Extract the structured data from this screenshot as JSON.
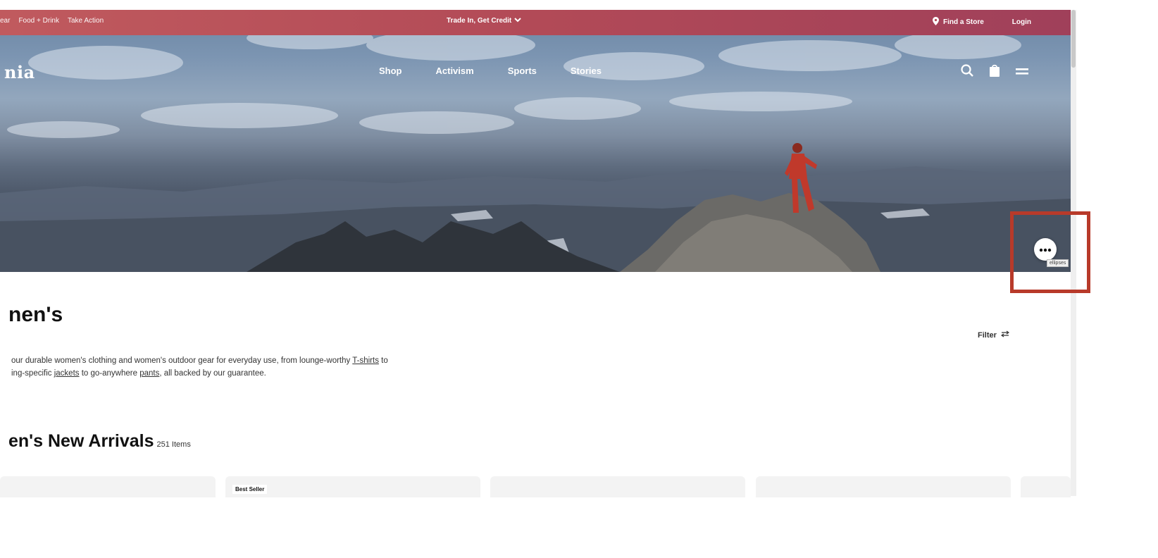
{
  "promo_bar": {
    "left_links": [
      "ear",
      "Food + Drink",
      "Take Action"
    ],
    "center_text": "Trade In, Get Credit",
    "find_store": "Find a Store",
    "login": "Login"
  },
  "nav": {
    "logo": "nia",
    "links": [
      "Shop",
      "Activism",
      "Sports",
      "Stories"
    ]
  },
  "page": {
    "title": "nen's",
    "description_line1_before": "our durable women's clothing and women's outdoor gear for everyday use, from lounge-worthy ",
    "link_tshirts": "T-shirts",
    "description_line1_after": " to",
    "description_line2_before": "ing-specific ",
    "link_jackets": "jackets",
    "description_line2_mid": " to go-anywhere ",
    "link_pants": "pants",
    "description_line2_after": ", all backed by our guarantee.",
    "filter_label": "Filter"
  },
  "section": {
    "title": "en's New Arrivals",
    "count": "251 Items"
  },
  "products": {
    "badge_best_seller": "Best Seller"
  },
  "chat": {
    "tooltip": "ellipses"
  },
  "colors": {
    "promo_bar": "#b24a57",
    "highlight": "#b83a2a"
  }
}
